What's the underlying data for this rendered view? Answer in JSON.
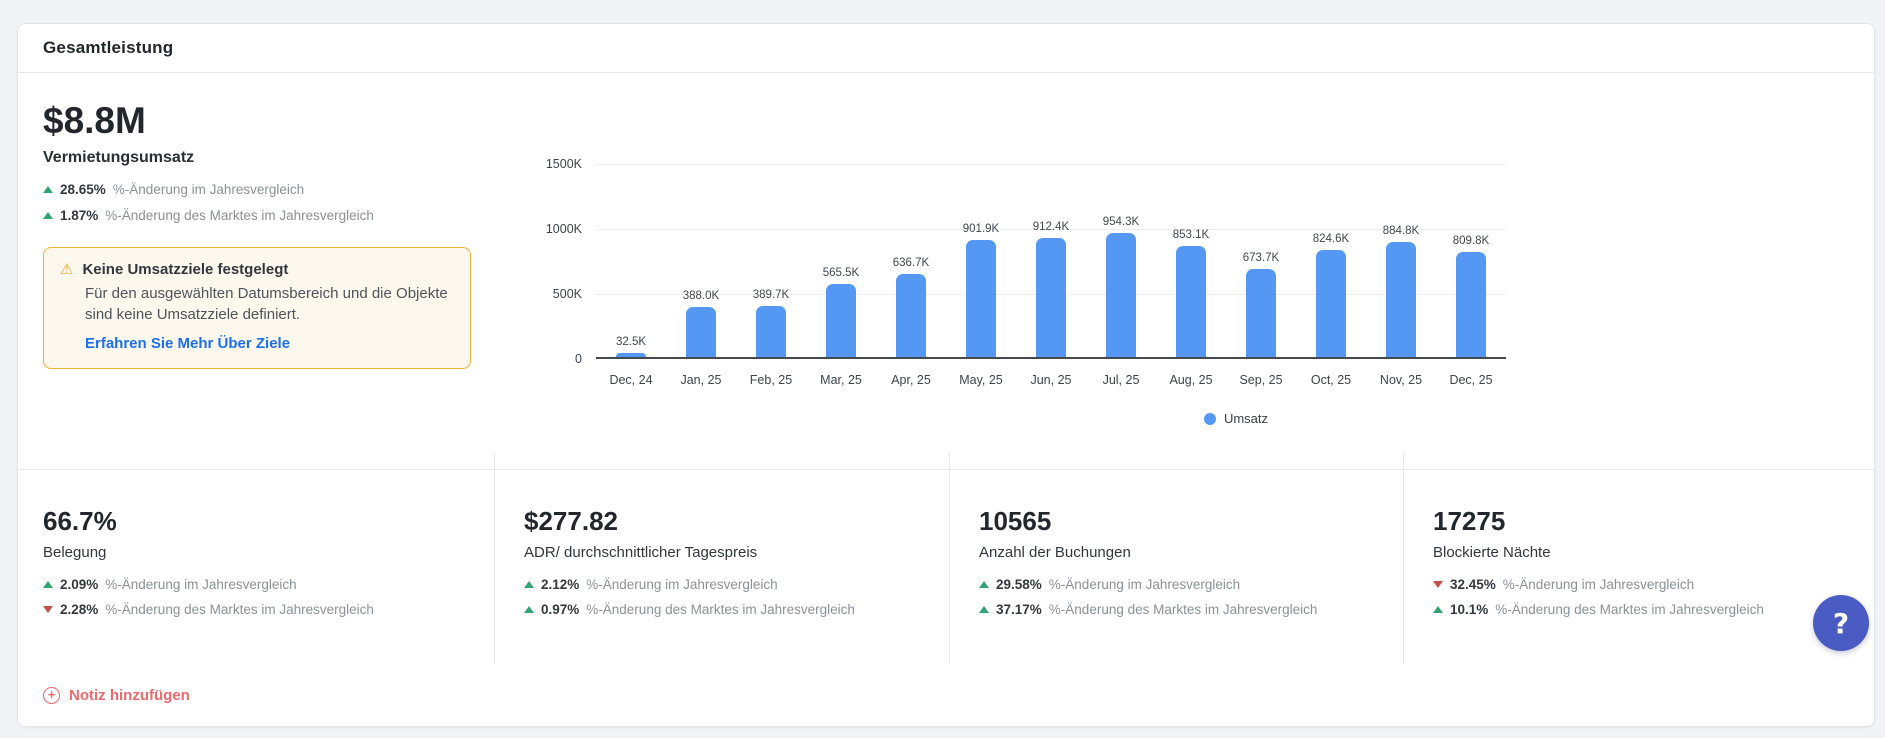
{
  "header": {
    "title": "Gesamtleistung"
  },
  "revenue": {
    "value": "$8.8M",
    "label": "Vermietungsumsatz",
    "changes": [
      {
        "dir": "up",
        "value": "28.65%",
        "label": "%-Änderung im Jahresvergleich"
      },
      {
        "dir": "up",
        "value": "1.87%",
        "label": "%-Änderung des Marktes im Jahresvergleich"
      }
    ]
  },
  "goal_notice": {
    "title": "Keine Umsatzziele festgelegt",
    "body": "Für den ausgewählten Datumsbereich und die Objekte sind keine Umsatzziele definiert.",
    "link": "Erfahren Sie Mehr Über Ziele"
  },
  "chart_data": {
    "type": "bar",
    "title": "",
    "xlabel": "",
    "ylabel": "",
    "unit": "K",
    "categories": [
      "Dec, 24",
      "Jan, 25",
      "Feb, 25",
      "Mar, 25",
      "Apr, 25",
      "May, 25",
      "Jun, 25",
      "Jul, 25",
      "Aug, 25",
      "Sep, 25",
      "Oct, 25",
      "Nov, 25",
      "Dec, 25"
    ],
    "values": [
      32.5,
      388.0,
      389.7,
      565.5,
      636.7,
      901.9,
      912.4,
      954.3,
      853.1,
      673.7,
      824.6,
      884.8,
      809.8
    ],
    "value_labels": [
      "32.5K",
      "388.0K",
      "389.7K",
      "565.5K",
      "636.7K",
      "901.9K",
      "912.4K",
      "954.3K",
      "853.1K",
      "673.7K",
      "824.6K",
      "884.8K",
      "809.8K"
    ],
    "ylim": [
      0,
      1500
    ],
    "yticks": [
      {
        "label": "0",
        "value": 0
      },
      {
        "label": "500K",
        "value": 500
      },
      {
        "label": "1000K",
        "value": 1000
      },
      {
        "label": "1500K",
        "value": 1500
      }
    ],
    "grid": true,
    "legend_position": "bottom",
    "legend_label": "Umsatz",
    "series_name": "Umsatz",
    "bar_color": "#5598f3"
  },
  "kpis": [
    {
      "value": "66.7%",
      "label": "Belegung",
      "changes": [
        {
          "dir": "up",
          "value": "2.09%",
          "label": "%-Änderung im Jahresvergleich"
        },
        {
          "dir": "down",
          "value": "2.28%",
          "label": "%-Änderung des Marktes im Jahresvergleich"
        }
      ]
    },
    {
      "value": "$277.82",
      "label": "ADR/ durchschnittlicher Tagespreis",
      "changes": [
        {
          "dir": "up",
          "value": "2.12%",
          "label": "%-Änderung im Jahresvergleich"
        },
        {
          "dir": "up",
          "value": "0.97%",
          "label": "%-Änderung des Marktes im Jahresvergleich"
        }
      ]
    },
    {
      "value": "10565",
      "label": "Anzahl der Buchungen",
      "changes": [
        {
          "dir": "up",
          "value": "29.58%",
          "label": "%-Änderung im Jahresvergleich"
        },
        {
          "dir": "up",
          "value": "37.17%",
          "label": "%-Änderung des Marktes im Jahresvergleich"
        }
      ]
    },
    {
      "value": "17275",
      "label": "Blockierte Nächte",
      "changes": [
        {
          "dir": "down",
          "value": "32.45%",
          "label": "%-Änderung im Jahresvergleich"
        },
        {
          "dir": "up",
          "value": "10.1%",
          "label": "%-Änderung des Marktes im Jahresvergleich"
        }
      ]
    }
  ],
  "footer": {
    "add_note": "Notiz hinzufügen"
  },
  "icons": {
    "plus": "+",
    "help": "?",
    "warning": "⚠"
  },
  "colors": {
    "positive": "#33a374",
    "negative": "#bf5049",
    "bar": "#5598f3",
    "link": "#1d6ef2",
    "note_accent": "#ee686c",
    "warning_border": "#ecb23f",
    "warning_bg": "#fdf8ed",
    "help_button": "#4a5bc4"
  }
}
